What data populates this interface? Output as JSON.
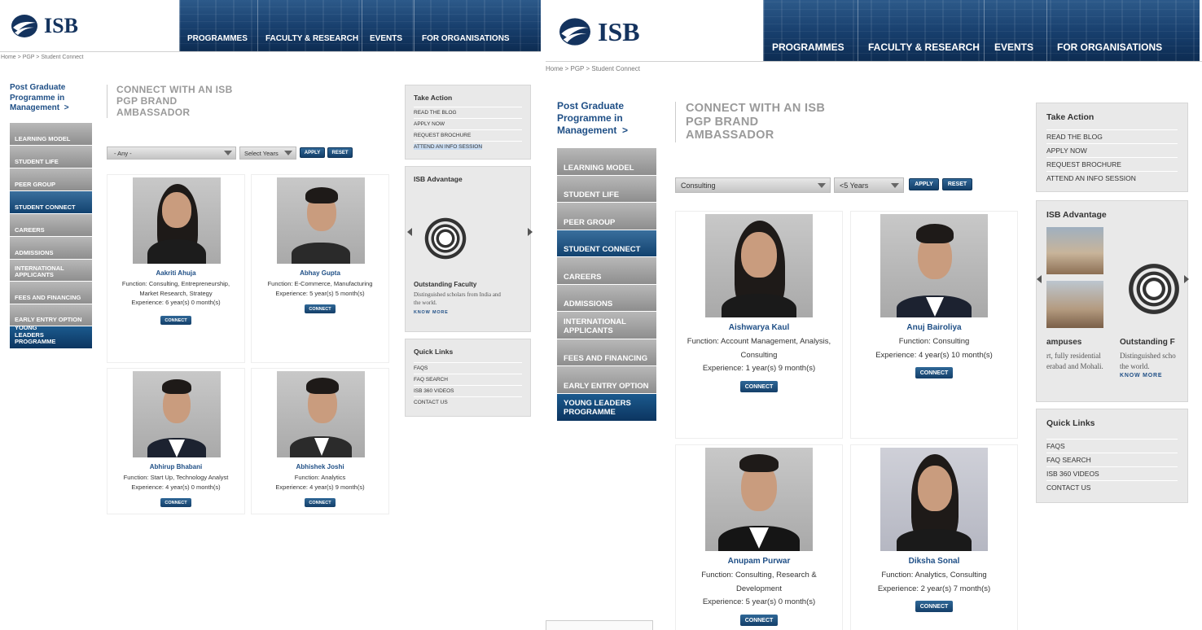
{
  "site": {
    "logo_text": "ISB"
  },
  "nav": [
    "PROGRAMMES",
    "FACULTY & RESEARCH",
    "EVENTS",
    "FOR ORGANISATIONS"
  ],
  "breadcrumb": [
    "Home",
    ">",
    "PGP",
    ">",
    "Student Connect"
  ],
  "pgp_link": {
    "line1": "Post Graduate",
    "line2": "Programme in",
    "line3": "Management",
    "arrow": ">"
  },
  "sidenav": [
    "LEARNING MODEL",
    "STUDENT LIFE",
    "PEER GROUP",
    "STUDENT CONNECT",
    "CAREERS",
    "ADMISSIONS",
    "INTERNATIONAL APPLICANTS",
    "FEES AND FINANCING",
    "EARLY ENTRY OPTION",
    "YOUNG LEADERS PROGRAMME"
  ],
  "page_title": {
    "line1": "CONNECT WITH AN ISB",
    "line2": "PGP BRAND",
    "line3": "AMBASSADOR"
  },
  "buttons": {
    "apply": "APPLY",
    "reset": "RESET",
    "connect": "CONNECT"
  },
  "take_action": {
    "title": "Take Action",
    "links": [
      "READ THE BLOG",
      "APPLY NOW",
      "REQUEST BROCHURE",
      "ATTEND AN INFO SESSION"
    ]
  },
  "isb_advantage": {
    "title": "ISB Advantage",
    "left_slide": {
      "caption": "Outstanding Faculty",
      "text_l1": "Distinguished scholars from India and",
      "text_l2": "the world.",
      "link": "KNOW MORE"
    },
    "right_campus": {
      "caption": "ampuses",
      "text_l1": "rt, fully residential",
      "text_l2": "erabad and Mohali."
    },
    "right_faculty": {
      "caption": "Outstanding F",
      "text_l1": "Distinguished scho",
      "text_l2": "the world.",
      "link": "KNOW MORE"
    }
  },
  "quick_links": {
    "title": "Quick Links",
    "links": [
      "FAQS",
      "FAQ SEARCH",
      "ISB 360 VIDEOS",
      "CONTACT US"
    ]
  },
  "left_filters": {
    "function": "- Any -",
    "years": "Select Years"
  },
  "right_filters": {
    "function": "Consulting",
    "years": "<5 Years"
  },
  "left_cards": [
    {
      "name": "Aakriti Ahuja",
      "l1": "Function: Consulting, Entrepreneurship,",
      "l2": "Market Research, Strategy",
      "l3": "Experience: 6 year(s) 0 month(s)"
    },
    {
      "name": "Abhay Gupta",
      "l1": "Function: E-Commerce, Manufacturing",
      "l2": "Experience: 5 year(s) 5 month(s)",
      "l3": ""
    },
    {
      "name": "Abhirup Bhabani",
      "l1": "Function: Start Up, Technology Analyst",
      "l2": "Experience: 4 year(s) 0 month(s)",
      "l3": ""
    },
    {
      "name": "Abhishek Joshi",
      "l1": "Function: Analytics",
      "l2": "Experience: 4 year(s) 9 month(s)",
      "l3": ""
    }
  ],
  "right_cards": [
    {
      "name": "Aishwarya Kaul",
      "l1": "Function: Account Management, Analysis,",
      "l2": "Consulting",
      "l3": "Experience: 1 year(s) 9 month(s)"
    },
    {
      "name": "Anuj Bairoliya",
      "l1": "Function: Consulting",
      "l2": "Experience: 4 year(s) 10 month(s)",
      "l3": ""
    },
    {
      "name": "Anupam Purwar",
      "l1": "Function: Consulting, Research &",
      "l2": "Development",
      "l3": "Experience: 5 year(s) 0 month(s)"
    },
    {
      "name": "Diksha Sonal",
      "l1": "Function: Analytics, Consulting",
      "l2": "Experience: 2 year(s) 7 month(s)",
      "l3": ""
    }
  ],
  "colors": {
    "brand_blue": "#14335e",
    "link_blue": "#1f4f86",
    "nav_gray": "#9a9a9a",
    "highlight": "#c9dcf2"
  }
}
